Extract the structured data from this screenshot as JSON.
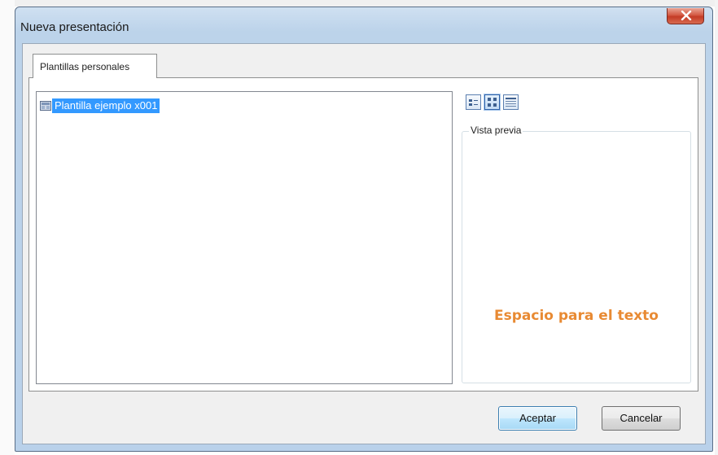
{
  "window": {
    "title": "Nueva presentación"
  },
  "tabs": [
    {
      "label": "Plantillas personales"
    }
  ],
  "templates": [
    {
      "label": "Plantilla ejemplo x001",
      "selected": true
    }
  ],
  "view_modes": [
    {
      "icon": "list-view-icon"
    },
    {
      "icon": "large-icons-view-icon",
      "active": true
    },
    {
      "icon": "details-view-icon"
    }
  ],
  "preview": {
    "legend": "Vista previa",
    "placeholder_text": "Espacio para el texto"
  },
  "buttons": {
    "ok": "Aceptar",
    "cancel": "Cancelar"
  },
  "colors": {
    "selection": "#3399ff",
    "preview_text": "#e88a33",
    "close_button": "#c43b25"
  }
}
